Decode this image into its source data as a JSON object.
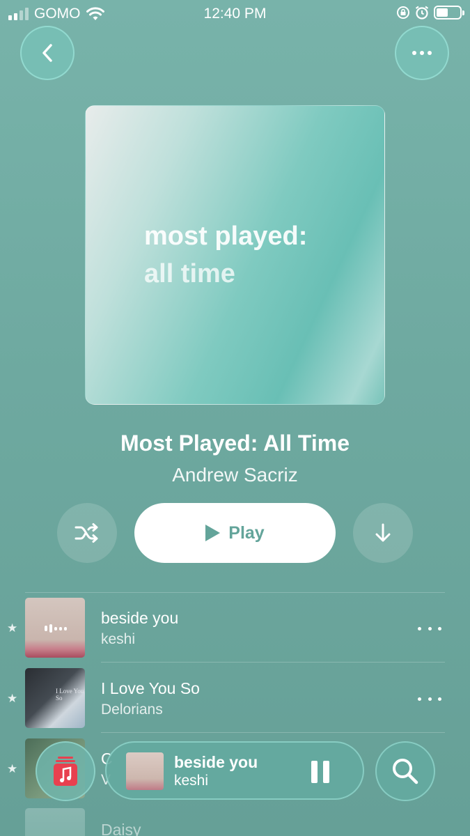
{
  "status_bar": {
    "carrier": "GOMO",
    "time": "12:40 PM",
    "icons": [
      "signal-icon",
      "wifi-icon",
      "rotation-lock-icon",
      "alarm-icon",
      "battery-icon"
    ]
  },
  "header": {
    "back_icon": "chevron-left-icon",
    "more_icon": "ellipsis-icon"
  },
  "artwork": {
    "line1": "most played:",
    "line2": "all time"
  },
  "playlist": {
    "title": "Most Played: All Time",
    "owner": "Andrew Sacriz"
  },
  "controls": {
    "shuffle_icon": "shuffle-icon",
    "play_label": "Play",
    "download_icon": "download-arrow-icon"
  },
  "tracks": [
    {
      "title": "beside you",
      "artist": "keshi",
      "favorite": true,
      "now_playing": true
    },
    {
      "title": "I Love You So",
      "artist": "Delorians",
      "favorite": true,
      "cover_text": "I Love You So"
    },
    {
      "title": "C",
      "artist": "V",
      "favorite": true
    },
    {
      "title": "Daisy",
      "artist": "",
      "favorite": false
    }
  ],
  "mini_player": {
    "title": "beside you",
    "artist": "keshi",
    "state_icon": "pause-icon"
  },
  "bottom_nav": {
    "library_icon": "music-library-icon",
    "search_icon": "search-icon"
  },
  "colors": {
    "background": "#6ea9a0",
    "accent": "#63a49a",
    "library_red": "#e8404f"
  }
}
